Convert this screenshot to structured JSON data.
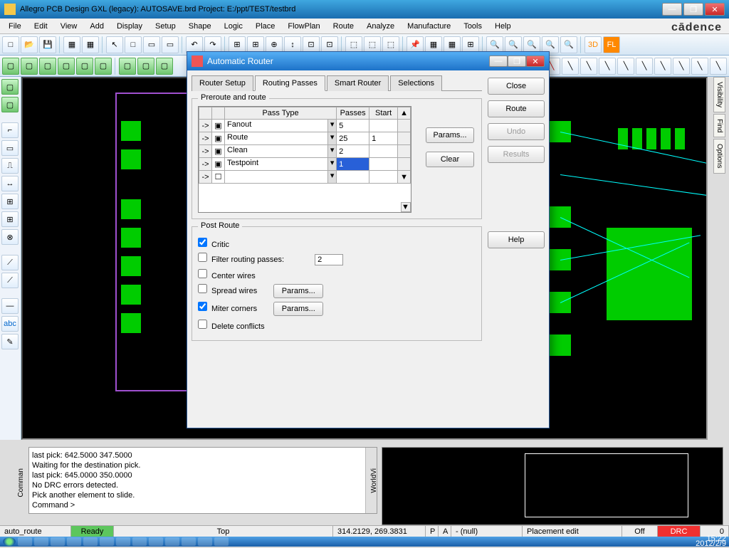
{
  "window": {
    "title": "Allegro PCB Design GXL (legacy): AUTOSAVE.brd  Project: E:/ppt/TEST/testbrd",
    "brand": "cādence"
  },
  "menu": [
    "File",
    "Edit",
    "View",
    "Add",
    "Display",
    "Setup",
    "Shape",
    "Logic",
    "Place",
    "FlowPlan",
    "Route",
    "Analyze",
    "Manufacture",
    "Tools",
    "Help"
  ],
  "right_tabs": [
    "Visibility",
    "Find",
    "Options"
  ],
  "dialog": {
    "title": "Automatic Router",
    "tabs": [
      "Router Setup",
      "Routing Passes",
      "Smart Router",
      "Selections"
    ],
    "active_tab": 1,
    "preroute_legend": "Preroute and route",
    "headers": {
      "pass_type": "Pass Type",
      "passes": "Passes",
      "start": "Start"
    },
    "rows": [
      {
        "enabled": true,
        "type": "Fanout",
        "passes": "5",
        "start": ""
      },
      {
        "enabled": true,
        "type": "Route",
        "passes": "25",
        "start": "1"
      },
      {
        "enabled": true,
        "type": "Clean",
        "passes": "2",
        "start": ""
      },
      {
        "enabled": true,
        "type": "Testpoint",
        "passes": "1",
        "start": "",
        "selected": true
      },
      {
        "enabled": false,
        "type": "",
        "passes": "",
        "start": ""
      }
    ],
    "side": {
      "params": "Params...",
      "clear": "Clear"
    },
    "postroute": {
      "legend": "Post Route",
      "critic": "Critic",
      "filter": "Filter routing passes:",
      "filter_val": "2",
      "center": "Center wires",
      "spread": "Spread wires",
      "miter": "Miter corners",
      "delete": "Delete conflicts",
      "params": "Params..."
    },
    "buttons": {
      "close": "Close",
      "route": "Route",
      "undo": "Undo",
      "results": "Results",
      "help": "Help"
    }
  },
  "command_log": [
    "last pick:  642.5000  347.5000",
    "Waiting for the destination pick.",
    "last pick:  645.0000  350.0000",
    "No DRC errors detected.",
    "Pick another element to slide.",
    "Command >"
  ],
  "cmd_label": "Comman",
  "world_label": "WorldVi",
  "status": {
    "mode": "auto_route",
    "ready": "Ready",
    "layer": "Top",
    "coords": "314.2129, 269.3831",
    "p": "P",
    "a": "A",
    "null": "- (null)",
    "edit": "Placement edit",
    "off": "Off",
    "drc": "DRC",
    "zero": "0"
  },
  "clock": {
    "time": "15:22",
    "date": "2012/2/9"
  }
}
